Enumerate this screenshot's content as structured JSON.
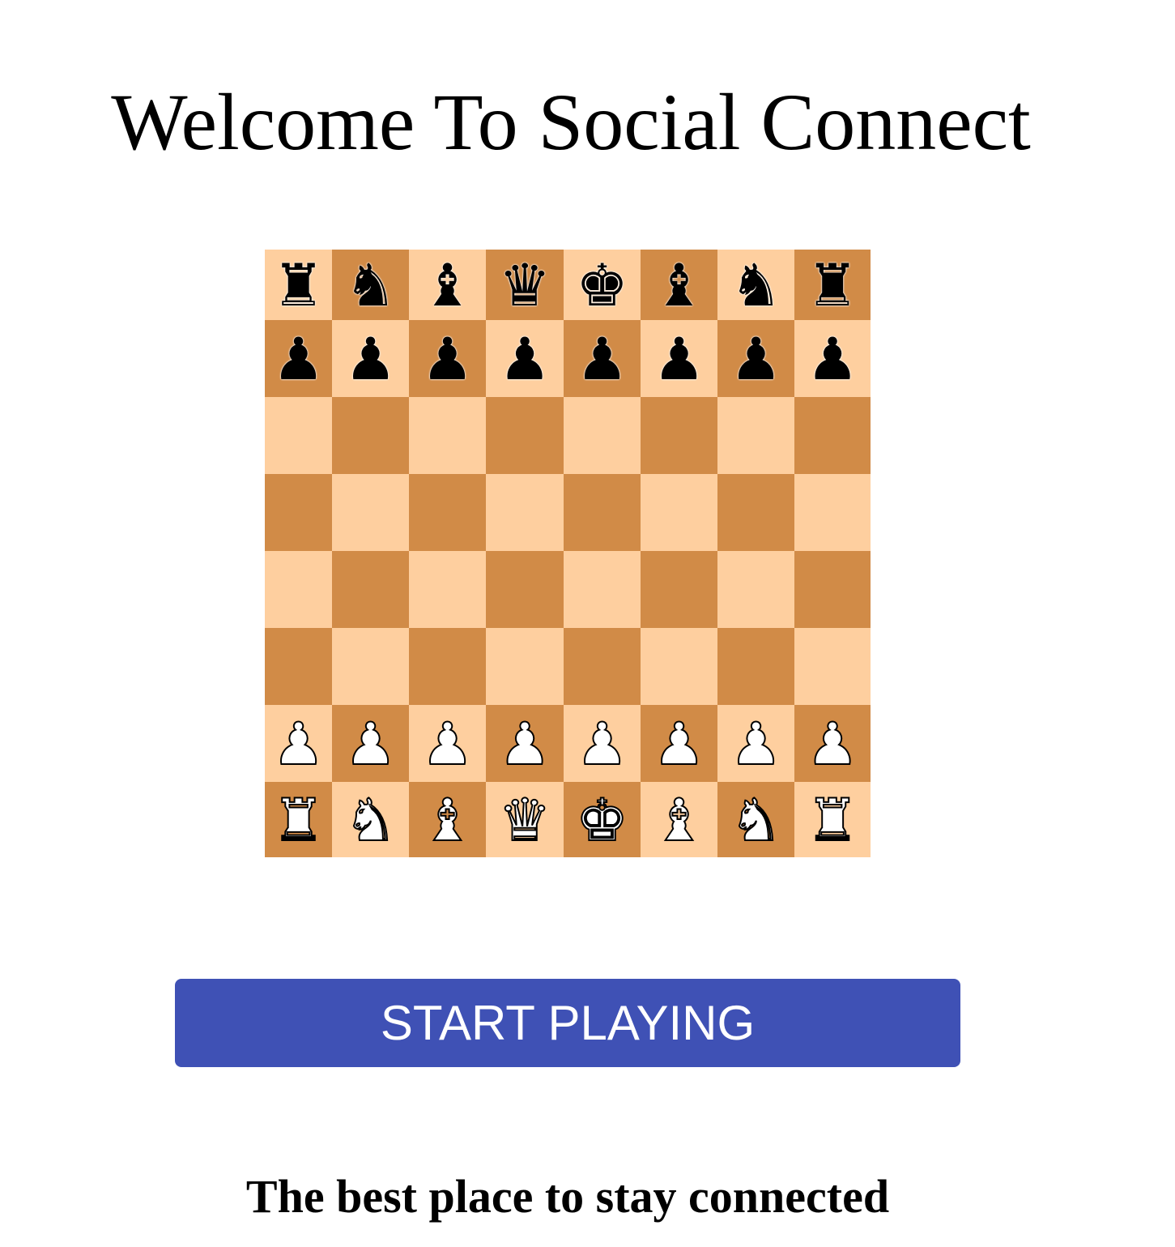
{
  "header": {
    "title": "Welcome To Social Connect"
  },
  "board": {
    "colors": {
      "light_square": "#fecf9f",
      "dark_square": "#d18b47"
    },
    "ranks": [
      [
        "black-rook",
        "black-knight",
        "black-bishop",
        "black-queen",
        "black-king",
        "black-bishop",
        "black-knight",
        "black-rook"
      ],
      [
        "black-pawn",
        "black-pawn",
        "black-pawn",
        "black-pawn",
        "black-pawn",
        "black-pawn",
        "black-pawn",
        "black-pawn"
      ],
      [
        "",
        "",
        "",
        "",
        "",
        "",
        "",
        ""
      ],
      [
        "",
        "",
        "",
        "",
        "",
        "",
        "",
        ""
      ],
      [
        "",
        "",
        "",
        "",
        "",
        "",
        "",
        ""
      ],
      [
        "",
        "",
        "",
        "",
        "",
        "",
        "",
        ""
      ],
      [
        "white-pawn",
        "white-pawn",
        "white-pawn",
        "white-pawn",
        "white-pawn",
        "white-pawn",
        "white-pawn",
        "white-pawn"
      ],
      [
        "white-rook",
        "white-knight",
        "white-bishop",
        "white-queen",
        "white-king",
        "white-bishop",
        "white-knight",
        "white-rook"
      ]
    ]
  },
  "actions": {
    "start_label": "START PLAYING",
    "button_color": "#3f51b5"
  },
  "footer": {
    "tagline": "The best place to stay connected"
  }
}
